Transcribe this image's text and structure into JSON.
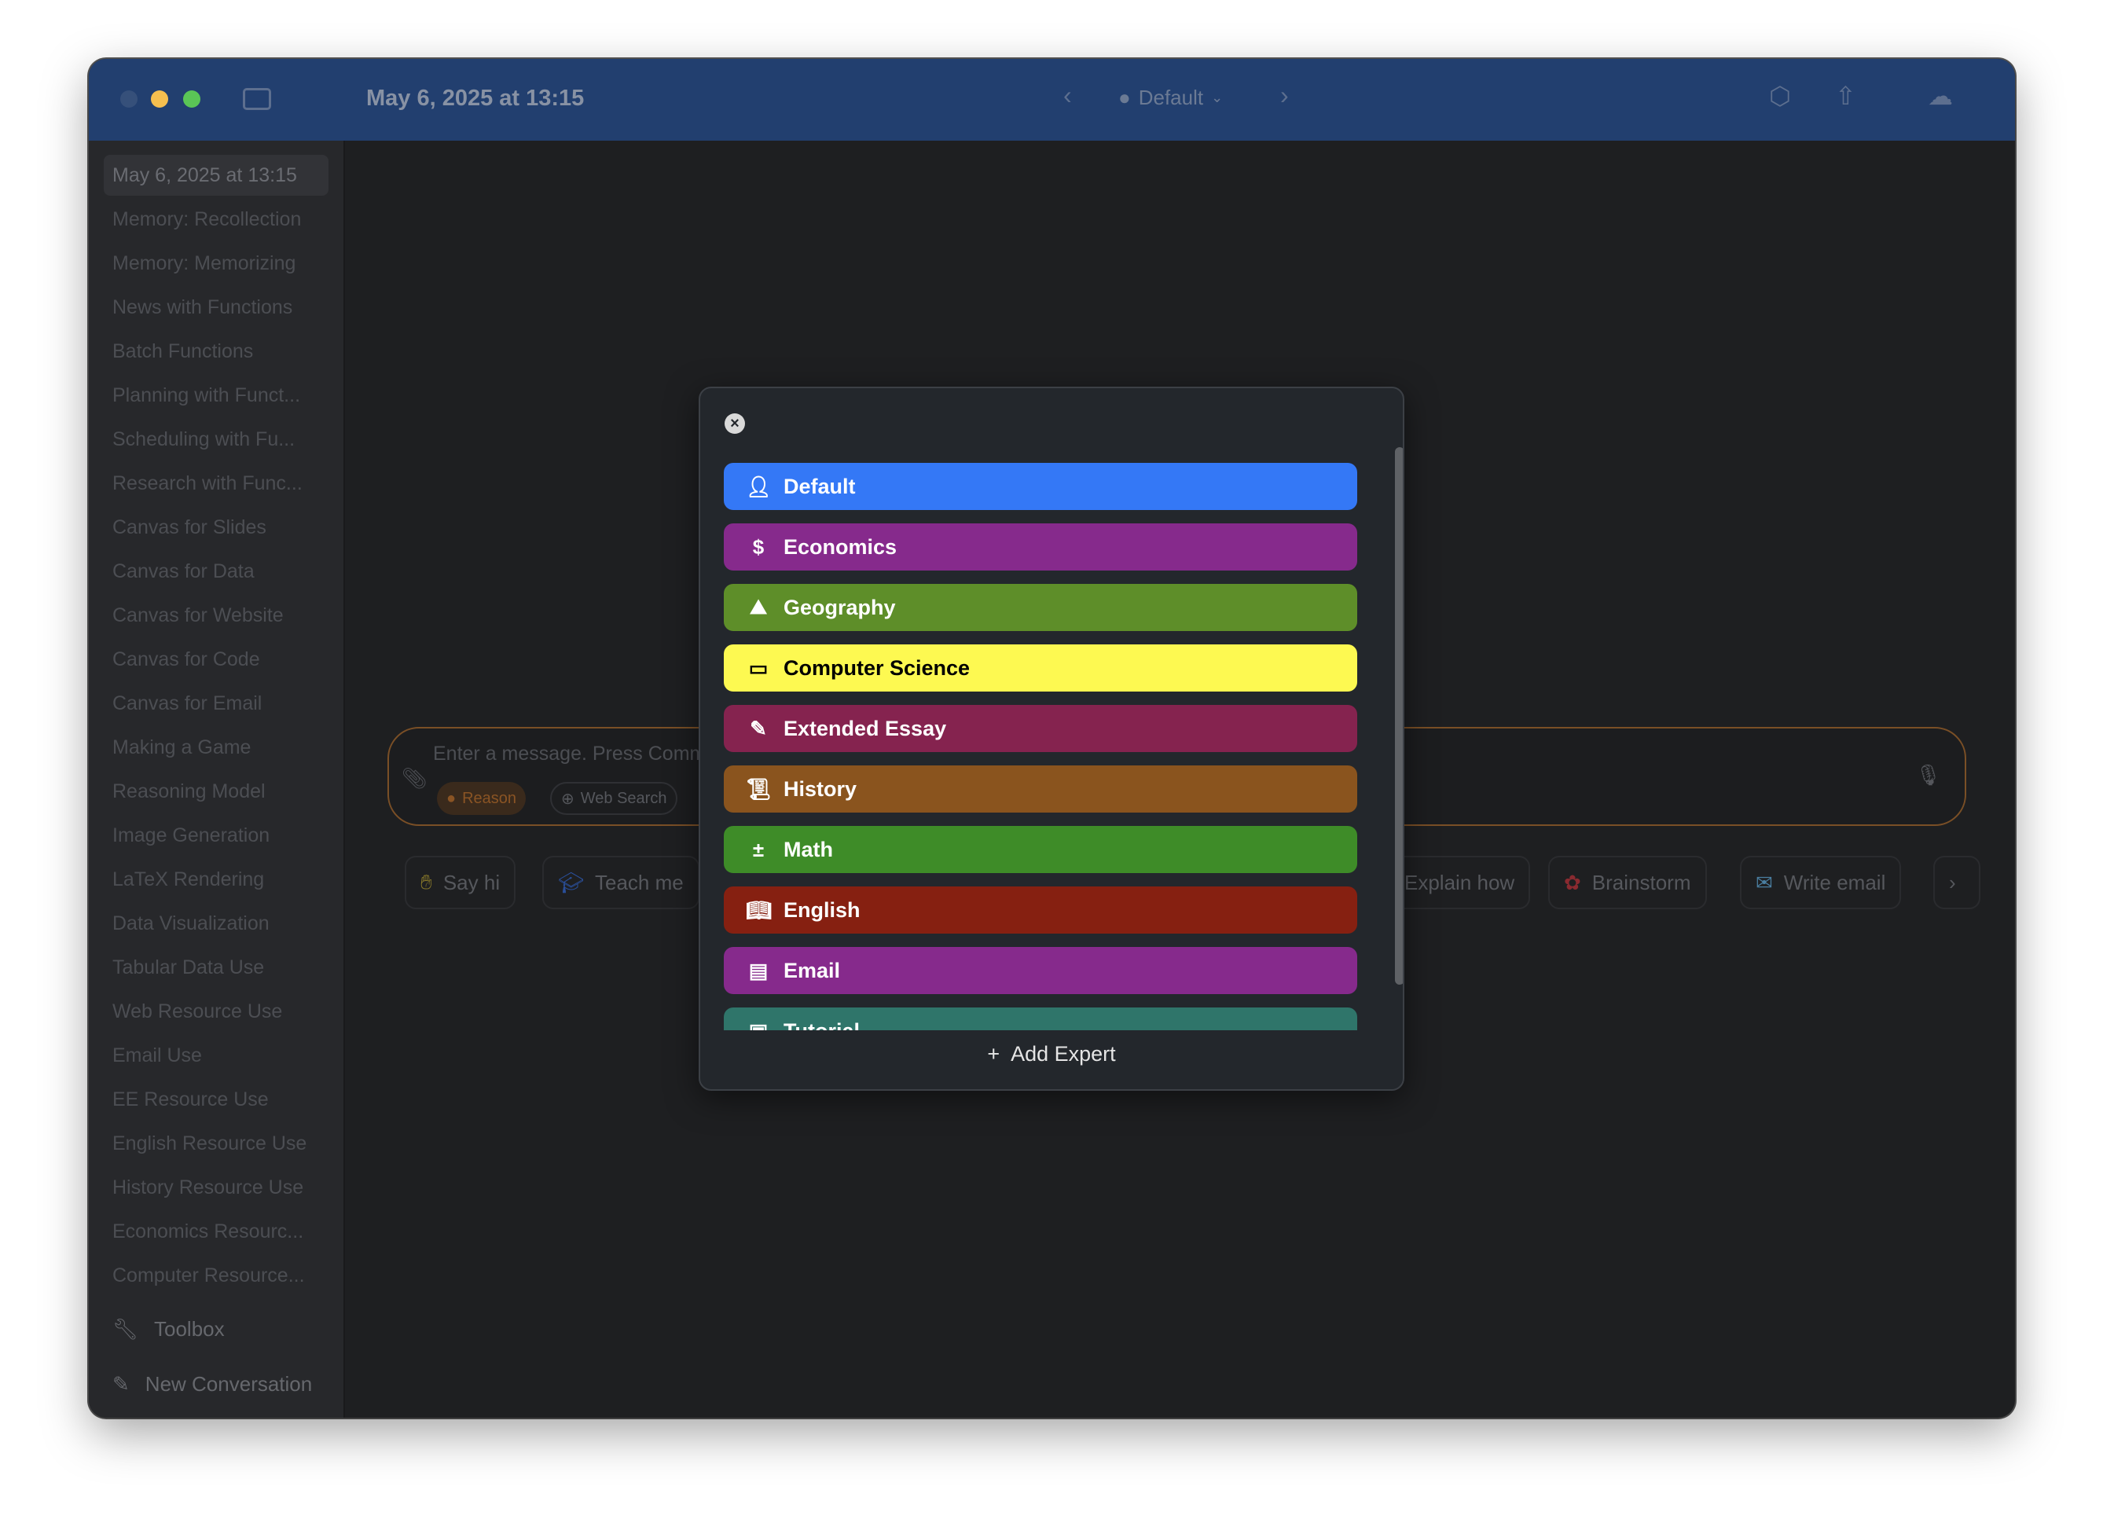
{
  "titlebar": {
    "title": "May 6, 2025 at 13:15",
    "expert": "Default"
  },
  "sidebar": {
    "items": [
      "May 6, 2025 at 13:15",
      "Memory: Recollection",
      "Memory: Memorizing",
      "News with Functions",
      "Batch Functions",
      "Planning with Funct...",
      "Scheduling with Fu...",
      "Research with Func...",
      "Canvas for Slides",
      "Canvas for Data",
      "Canvas for Website",
      "Canvas for Code",
      "Canvas for Email",
      "Making a Game",
      "Reasoning Model",
      "Image Generation",
      "LaTeX Rendering",
      "Data Visualization",
      "Tabular Data Use",
      "Web Resource Use",
      "Email Use",
      "EE Resource Use",
      "English Resource Use",
      "History Resource Use",
      "Economics Resourc...",
      "Computer Resource..."
    ],
    "toolbox": "Toolbox",
    "new_conversation": "New Conversation"
  },
  "input": {
    "placeholder": "Enter a message. Press Command + Return to send.",
    "reason": "Reason",
    "web_search": "Web Search"
  },
  "suggestions": [
    "Say hi",
    "Teach me",
    "Explain how",
    "Brainstorm",
    "Write email"
  ],
  "modal": {
    "experts": [
      {
        "label": "Default",
        "icon": "person-icon",
        "color": "#3478f6"
      },
      {
        "label": "Economics",
        "icon": "dollar-icon",
        "color": "#862a8c"
      },
      {
        "label": "Geography",
        "icon": "mountains-icon",
        "color": "#5e8e29"
      },
      {
        "label": "Computer Science",
        "icon": "memory-chip-icon",
        "color": "#fdf951"
      },
      {
        "label": "Extended Essay",
        "icon": "pencil-line-icon",
        "color": "#85234f"
      },
      {
        "label": "History",
        "icon": "scroll-icon",
        "color": "#8a541e"
      },
      {
        "label": "Math",
        "icon": "plus-minus-icon",
        "color": "#3e8c28"
      },
      {
        "label": "English",
        "icon": "book-icon",
        "color": "#862011"
      },
      {
        "label": "Email",
        "icon": "inbox-icon",
        "color": "#862a8c"
      },
      {
        "label": "Tutorial",
        "icon": "tutorial-icon",
        "color": "#2f756a"
      }
    ],
    "add_label": "Add Expert"
  }
}
